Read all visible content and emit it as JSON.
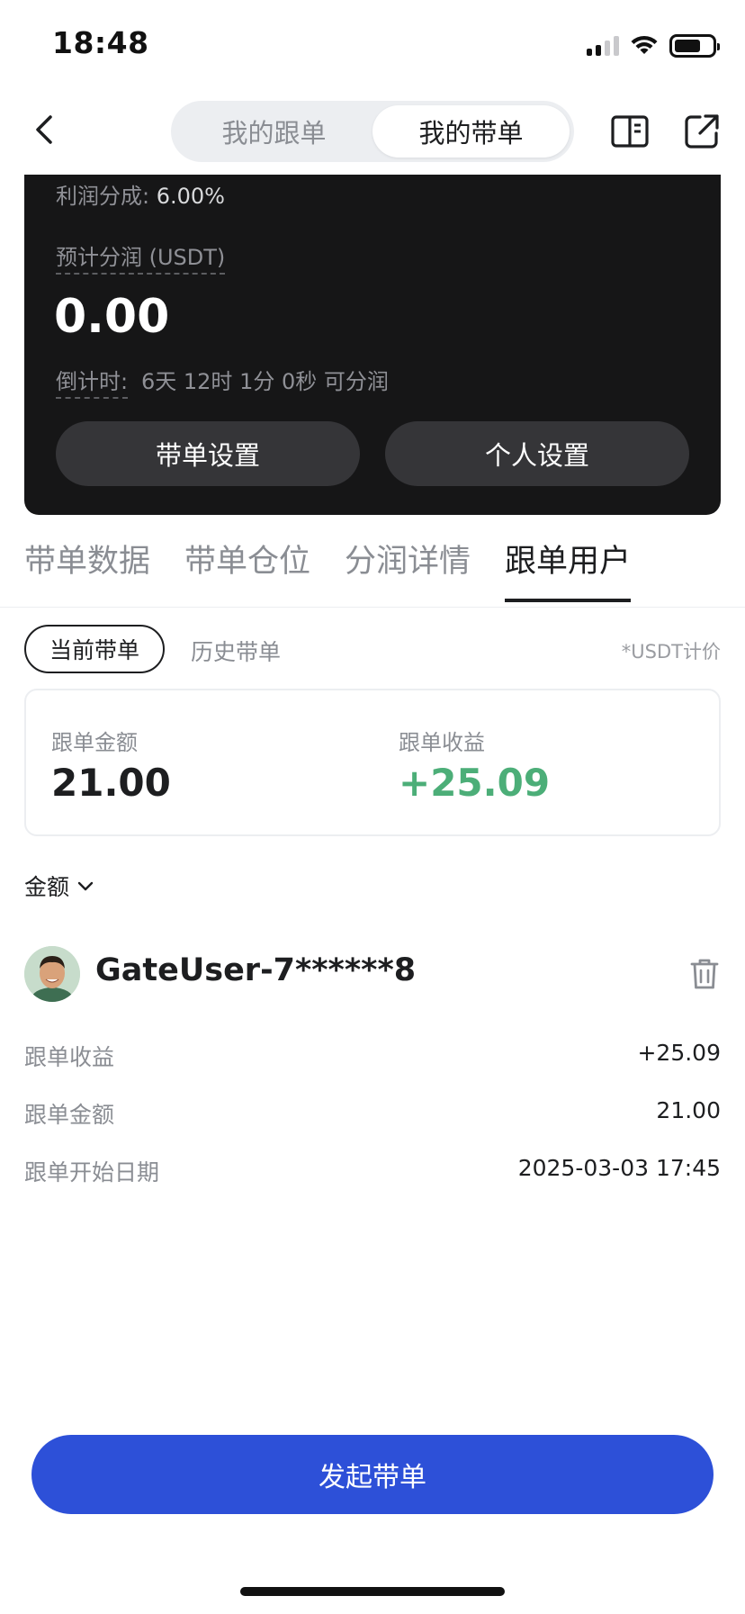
{
  "status_bar": {
    "time": "18:48"
  },
  "header": {
    "segments": [
      "我的跟单",
      "我的带单"
    ],
    "active_segment": 1,
    "icons": [
      "back-icon",
      "book-icon",
      "share-icon"
    ]
  },
  "dark_card": {
    "profit_share_label": "利润分成:",
    "profit_share_value": "6.00%",
    "estimated_label": "预计分润 (USDT)",
    "estimated_value": "0.00",
    "countdown_label": "倒计时:",
    "countdown_value": "6天 12时 1分 0秒 可分润",
    "buttons": [
      "带单设置",
      "个人设置"
    ]
  },
  "tabs": [
    "带单数据",
    "带单仓位",
    "分润详情",
    "跟单用户"
  ],
  "active_tab": 3,
  "filters": {
    "current": "当前带单",
    "history": "历史带单",
    "unit_note": "*USDT计价"
  },
  "summary": {
    "amount_label": "跟单金额",
    "amount_value": "21.00",
    "profit_label": "跟单收益",
    "profit_value": "+25.09"
  },
  "sort": {
    "label": "金额"
  },
  "follower": {
    "username": "GateUser-7******8",
    "rows": [
      {
        "label": "跟单收益",
        "value": "+25.09"
      },
      {
        "label": "跟单金额",
        "value": "21.00"
      },
      {
        "label": "跟单开始日期",
        "value": "2025-03-03 17:45"
      }
    ]
  },
  "cta": {
    "label": "发起带单"
  },
  "colors": {
    "accent": "#2d50d8",
    "profit_green": "#4cae78",
    "dark_card": "#161617"
  }
}
